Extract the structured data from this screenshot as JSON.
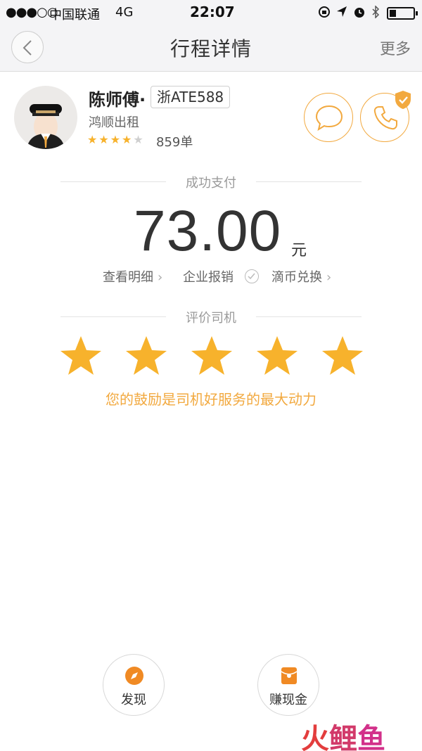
{
  "status_bar": {
    "signal": "●●●○○",
    "carrier": "中国联通",
    "network": "4G",
    "time": "22:07"
  },
  "nav": {
    "title": "行程详情",
    "more": "更多"
  },
  "driver": {
    "name": "陈师傅·",
    "plate": "浙ATE588",
    "company": "鸿顺出租",
    "rating": 4,
    "rating_max": 5,
    "orders": "859单"
  },
  "payment": {
    "status": "成功支付",
    "amount": "73.00",
    "currency": "元",
    "actions": {
      "detail": "查看明细",
      "expense": "企业报销",
      "exchange": "滴币兑换"
    }
  },
  "review": {
    "title": "评价司机",
    "stars": 5,
    "message": "您的鼓励是司机好服务的最大动力"
  },
  "bottom": {
    "discover": "发现",
    "earn": "赚现金"
  },
  "watermark": {
    "part1": "火",
    "part2": "鲤",
    "part3": "鱼"
  },
  "colors": {
    "accent": "#f2a93f",
    "star": "#f7b22c",
    "star_empty": "#cfcfcf"
  }
}
